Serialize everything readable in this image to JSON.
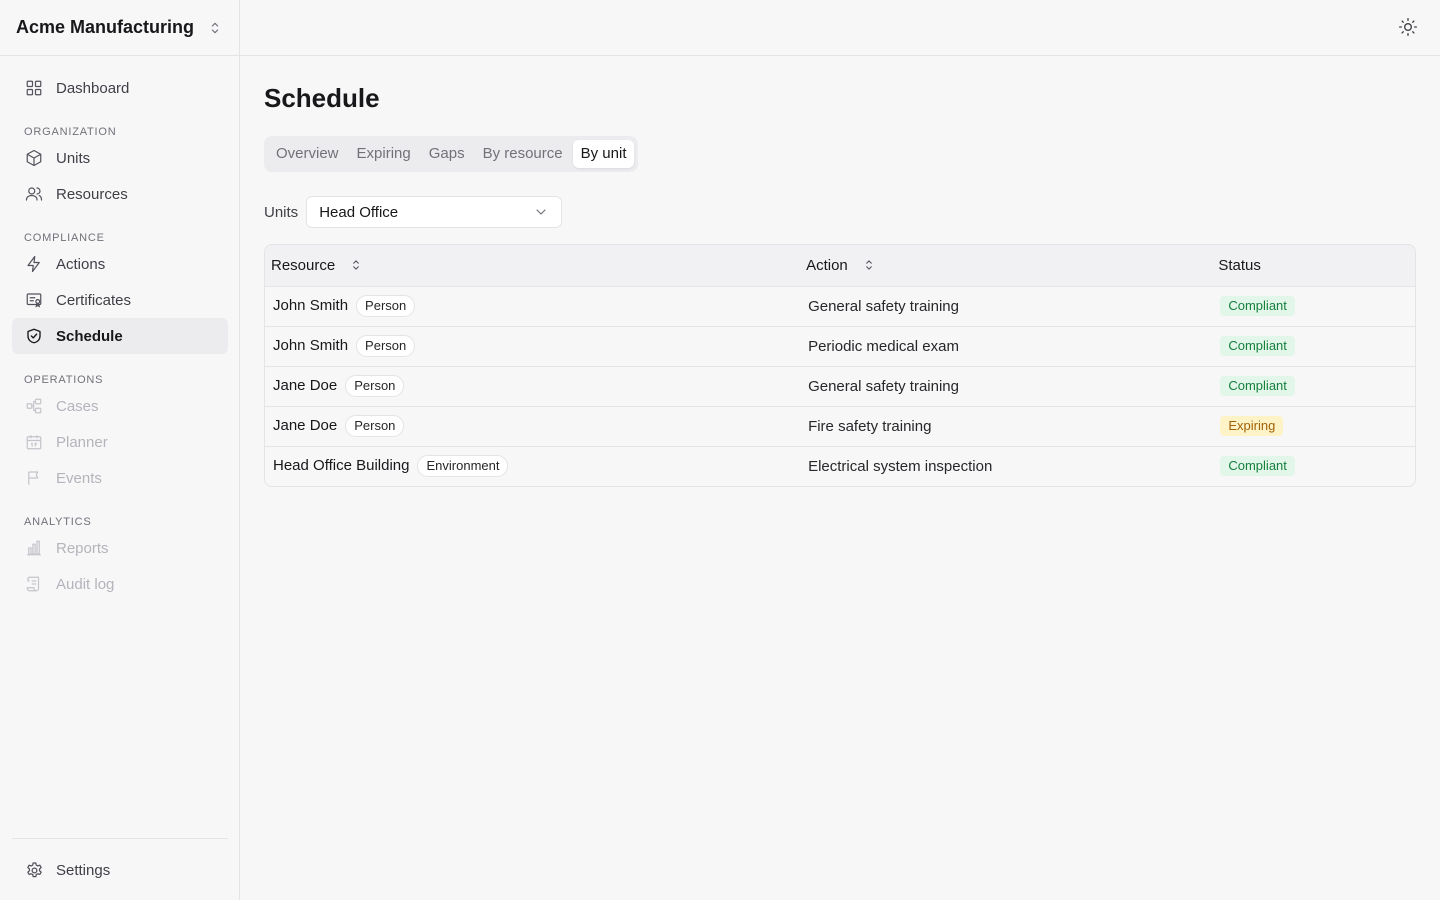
{
  "org": {
    "name": "Acme Manufacturing"
  },
  "sidebar": {
    "dashboard": {
      "label": "Dashboard"
    },
    "sections": {
      "organization": "ORGANIZATION",
      "compliance": "COMPLIANCE",
      "operations": "OPERATIONS",
      "analytics": "ANALYTICS"
    },
    "items": {
      "units": "Units",
      "resources": "Resources",
      "actions": "Actions",
      "certificates": "Certificates",
      "schedule": "Schedule",
      "cases": "Cases",
      "planner": "Planner",
      "events": "Events",
      "reports": "Reports",
      "audit_log": "Audit log"
    },
    "settings": "Settings"
  },
  "page": {
    "title": "Schedule"
  },
  "tabs": [
    "Overview",
    "Expiring",
    "Gaps",
    "By resource",
    "By unit"
  ],
  "active_tab": "By unit",
  "filter": {
    "label": "Units",
    "value": "Head Office"
  },
  "table": {
    "headers": {
      "resource": "Resource",
      "action": "Action",
      "status": "Status"
    },
    "rows": [
      {
        "name": "John Smith",
        "type": "Person",
        "action": "General safety training",
        "status": "Compliant"
      },
      {
        "name": "John Smith",
        "type": "Person",
        "action": "Periodic medical exam",
        "status": "Compliant"
      },
      {
        "name": "Jane Doe",
        "type": "Person",
        "action": "General safety training",
        "status": "Compliant"
      },
      {
        "name": "Jane Doe",
        "type": "Person",
        "action": "Fire safety training",
        "status": "Expiring"
      },
      {
        "name": "Head Office Building",
        "type": "Environment",
        "action": "Electrical system inspection",
        "status": "Compliant"
      }
    ]
  },
  "colors": {
    "compliant_bg": "#e3f6ea",
    "compliant_fg": "#15803d",
    "expiring_bg": "#fdf3c7",
    "expiring_fg": "#a16207"
  }
}
